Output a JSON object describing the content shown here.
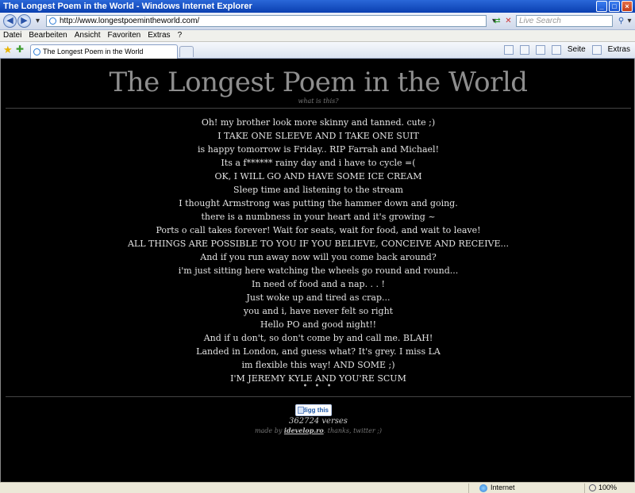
{
  "window": {
    "title": "The Longest Poem in the World - Windows Internet Explorer"
  },
  "addressbar": {
    "url": "http://www.longestpoemintheworld.com/",
    "search_placeholder": "Live Search"
  },
  "menu": [
    "Datei",
    "Bearbeiten",
    "Ansicht",
    "Favoriten",
    "Extras",
    "?"
  ],
  "tabs": [
    {
      "label": "The Longest Poem in the World"
    }
  ],
  "toolbar": {
    "page_label": "Seite",
    "extras_label": "Extras"
  },
  "page": {
    "title": "The Longest Poem in the World",
    "whatis": "what is this?",
    "lines": [
      "Oh! my brother look more skinny and tanned. cute ;)",
      "I TAKE ONE SLEEVE AND I TAKE ONE SUIT",
      "is happy tomorrow is Friday.. RIP Farrah and Michael!",
      "Its a f****** rainy day and i have to cycle =(",
      "OK, I WILL GO AND HAVE SOME ICE CREAM",
      "Sleep time and listening to the stream",
      "I thought Armstrong was putting the hammer down and going.",
      "there is a numbness in your heart and it's growing ~",
      "Ports o call takes forever! Wait for seats, wait for food, and wait to leave!",
      "ALL THINGS ARE POSSIBLE TO YOU IF YOU BELIEVE, CONCEIVE AND RECEIVE...",
      "And if you run away now will you come back around?",
      "i'm just sitting here watching the wheels go round and round...",
      "In need of food and a nap. . . !",
      "Just woke up  and tired as crap...",
      "you and i, have never felt so right",
      "Hello PO and good night!!",
      "And if u don't, so don't come by and call me. BLAH!",
      "Landed in London, and guess what? It's grey. I miss LA",
      "im flexible this way! AND SOME ;)",
      "I'M JEREMY KYLE AND YOU'RE SCUM"
    ],
    "dots": "• • •",
    "digg_label": "digg this",
    "verses": "362724 verses",
    "madeby_prefix": "made by",
    "madeby_link": "idevelop.ro",
    "madeby_suffix": ". thanks, twitter ;)"
  },
  "status": {
    "zone": "Internet",
    "zoom": "100%"
  },
  "colors": {
    "page_background": "#000000",
    "title_color": "#8e8e8e",
    "poem_text": "#e2e2e2"
  }
}
